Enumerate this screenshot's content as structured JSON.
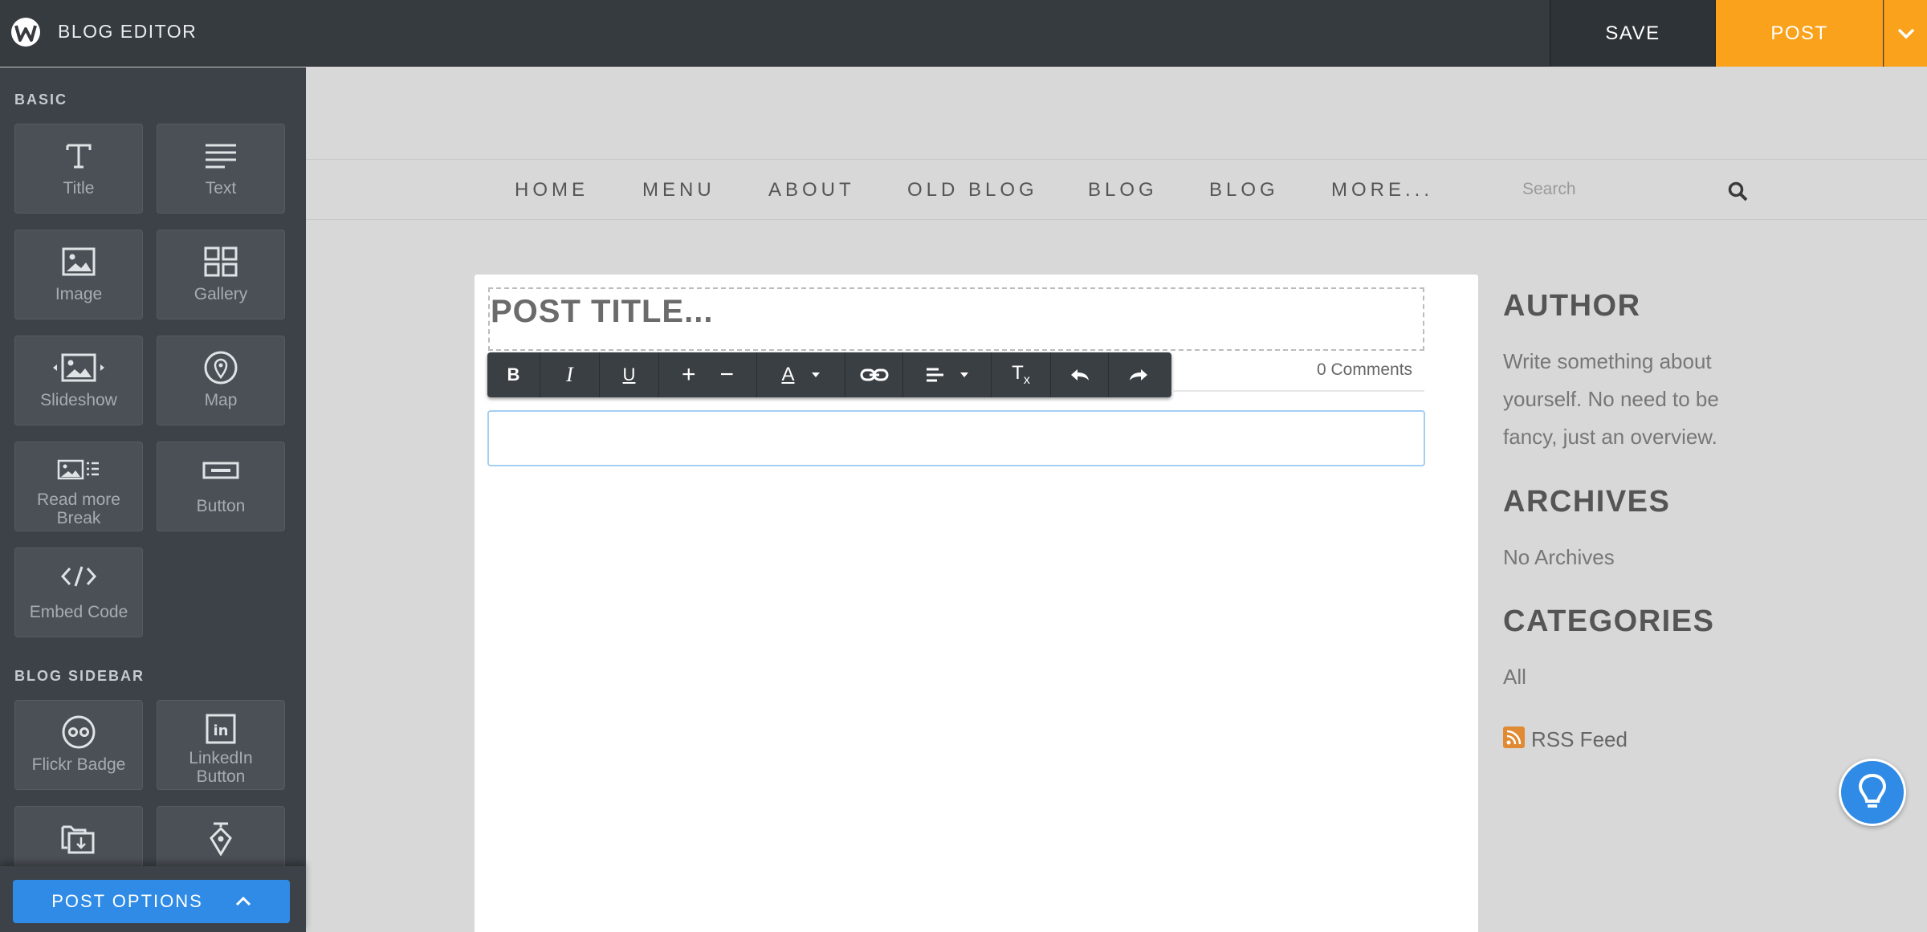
{
  "app": {
    "title": "BLOG EDITOR"
  },
  "header": {
    "save_label": "SAVE",
    "post_label": "POST"
  },
  "sidebar": {
    "basic_label": "BASIC",
    "basic_items": [
      {
        "label": "Title",
        "icon": "title-icon"
      },
      {
        "label": "Text",
        "icon": "text-icon"
      },
      {
        "label": "Image",
        "icon": "image-icon"
      },
      {
        "label": "Gallery",
        "icon": "gallery-icon"
      },
      {
        "label": "Slideshow",
        "icon": "slideshow-icon"
      },
      {
        "label": "Map",
        "icon": "map-pin-icon"
      },
      {
        "label": "Read more Break",
        "icon": "read-more-icon"
      },
      {
        "label": "Button",
        "icon": "button-icon"
      },
      {
        "label": "Embed Code",
        "icon": "code-icon"
      }
    ],
    "blog_sidebar_label": "BLOG SIDEBAR",
    "blog_sidebar_items": [
      {
        "label": "Flickr Badge",
        "icon": "flickr-icon"
      },
      {
        "label": "LinkedIn Button",
        "icon": "linkedin-icon"
      },
      {
        "label": "",
        "icon": "folder-download-icon"
      },
      {
        "label": "",
        "icon": "pen-nib-icon"
      }
    ],
    "post_options_label": "POST OPTIONS"
  },
  "nav": {
    "items": [
      "HOME",
      "MENU",
      "ABOUT",
      "OLD BLOG",
      "BLOG",
      "BLOG",
      "MORE..."
    ],
    "search_placeholder": "Search"
  },
  "post": {
    "title_placeholder": "POST TITLE...",
    "comments": "0 Comments"
  },
  "blog_sidebar": {
    "author_heading": "AUTHOR",
    "author_text": [
      "Write something about",
      "yourself. No need to be",
      "fancy, just an overview."
    ],
    "archives_heading": "ARCHIVES",
    "archives_text": "No Archives",
    "categories_heading": "CATEGORIES",
    "categories_text": "All",
    "rss_label": "RSS Feed"
  },
  "colors": {
    "accent_orange": "#faa21b",
    "accent_blue": "#2f8be6",
    "topbar": "#363b40",
    "sidebar": "#3c4247"
  }
}
